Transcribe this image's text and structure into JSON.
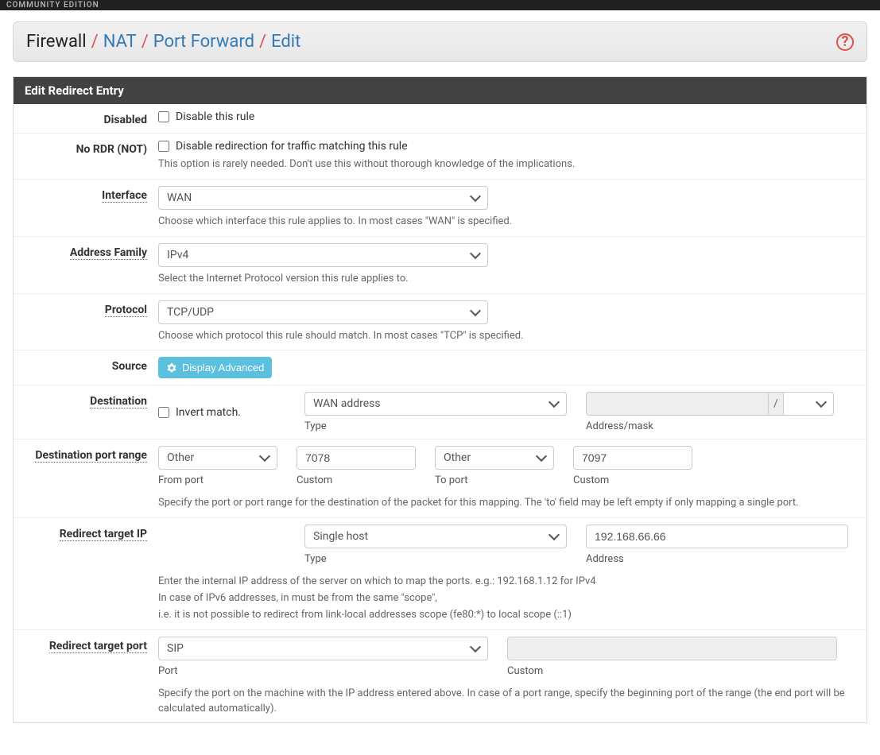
{
  "topbar": {
    "edition": "COMMUNITY EDITION"
  },
  "breadcrumb": {
    "root": "Firewall",
    "items": [
      "NAT",
      "Port Forward",
      "Edit"
    ]
  },
  "panel": {
    "title": "Edit Redirect Entry"
  },
  "fields": {
    "disabled": {
      "label": "Disabled",
      "checkbox_label": "Disable this rule"
    },
    "nordr": {
      "label": "No RDR (NOT)",
      "checkbox_label": "Disable redirection for traffic matching this rule",
      "help": "This option is rarely needed. Don't use this without thorough knowledge of the implications."
    },
    "interface": {
      "label": "Interface",
      "value": "WAN",
      "help": "Choose which interface this rule applies to. In most cases \"WAN\" is specified."
    },
    "address_family": {
      "label": "Address Family",
      "value": "IPv4",
      "help": "Select the Internet Protocol version this rule applies to."
    },
    "protocol": {
      "label": "Protocol",
      "value": "TCP/UDP",
      "help": "Choose which protocol this rule should match. In most cases \"TCP\" is specified."
    },
    "source": {
      "label": "Source",
      "button": "Display Advanced"
    },
    "destination": {
      "label": "Destination",
      "invert_label": "Invert match.",
      "type_value": "WAN address",
      "type_sub": "Type",
      "addr_value": "",
      "mask_value": "",
      "addr_sub": "Address/mask",
      "slash": "/"
    },
    "dest_port_range": {
      "label": "Destination port range",
      "from_type": "Other",
      "from_sub": "From port",
      "from_custom": "7078",
      "from_custom_sub": "Custom",
      "to_type": "Other",
      "to_sub": "To port",
      "to_custom": "7097",
      "to_custom_sub": "Custom",
      "help": "Specify the port or port range for the destination of the packet for this mapping. The 'to' field may be left empty if only mapping a single port."
    },
    "redirect_target_ip": {
      "label": "Redirect target IP",
      "type_value": "Single host",
      "type_sub": "Type",
      "addr_value": "192.168.66.66",
      "addr_sub": "Address",
      "help_l1": "Enter the internal IP address of the server on which to map the ports. e.g.: 192.168.1.12 for IPv4",
      "help_l2": "In case of IPv6 addresses, in must be from the same \"scope\",",
      "help_l3": "i.e. it is not possible to redirect from link-local addresses scope (fe80:*) to local scope (::1)"
    },
    "redirect_target_port": {
      "label": "Redirect target port",
      "port_value": "SIP",
      "port_sub": "Port",
      "custom_value": "",
      "custom_sub": "Custom",
      "help": "Specify the port on the machine with the IP address entered above. In case of a port range, specify the beginning port of the range (the end port will be calculated automatically)."
    }
  }
}
